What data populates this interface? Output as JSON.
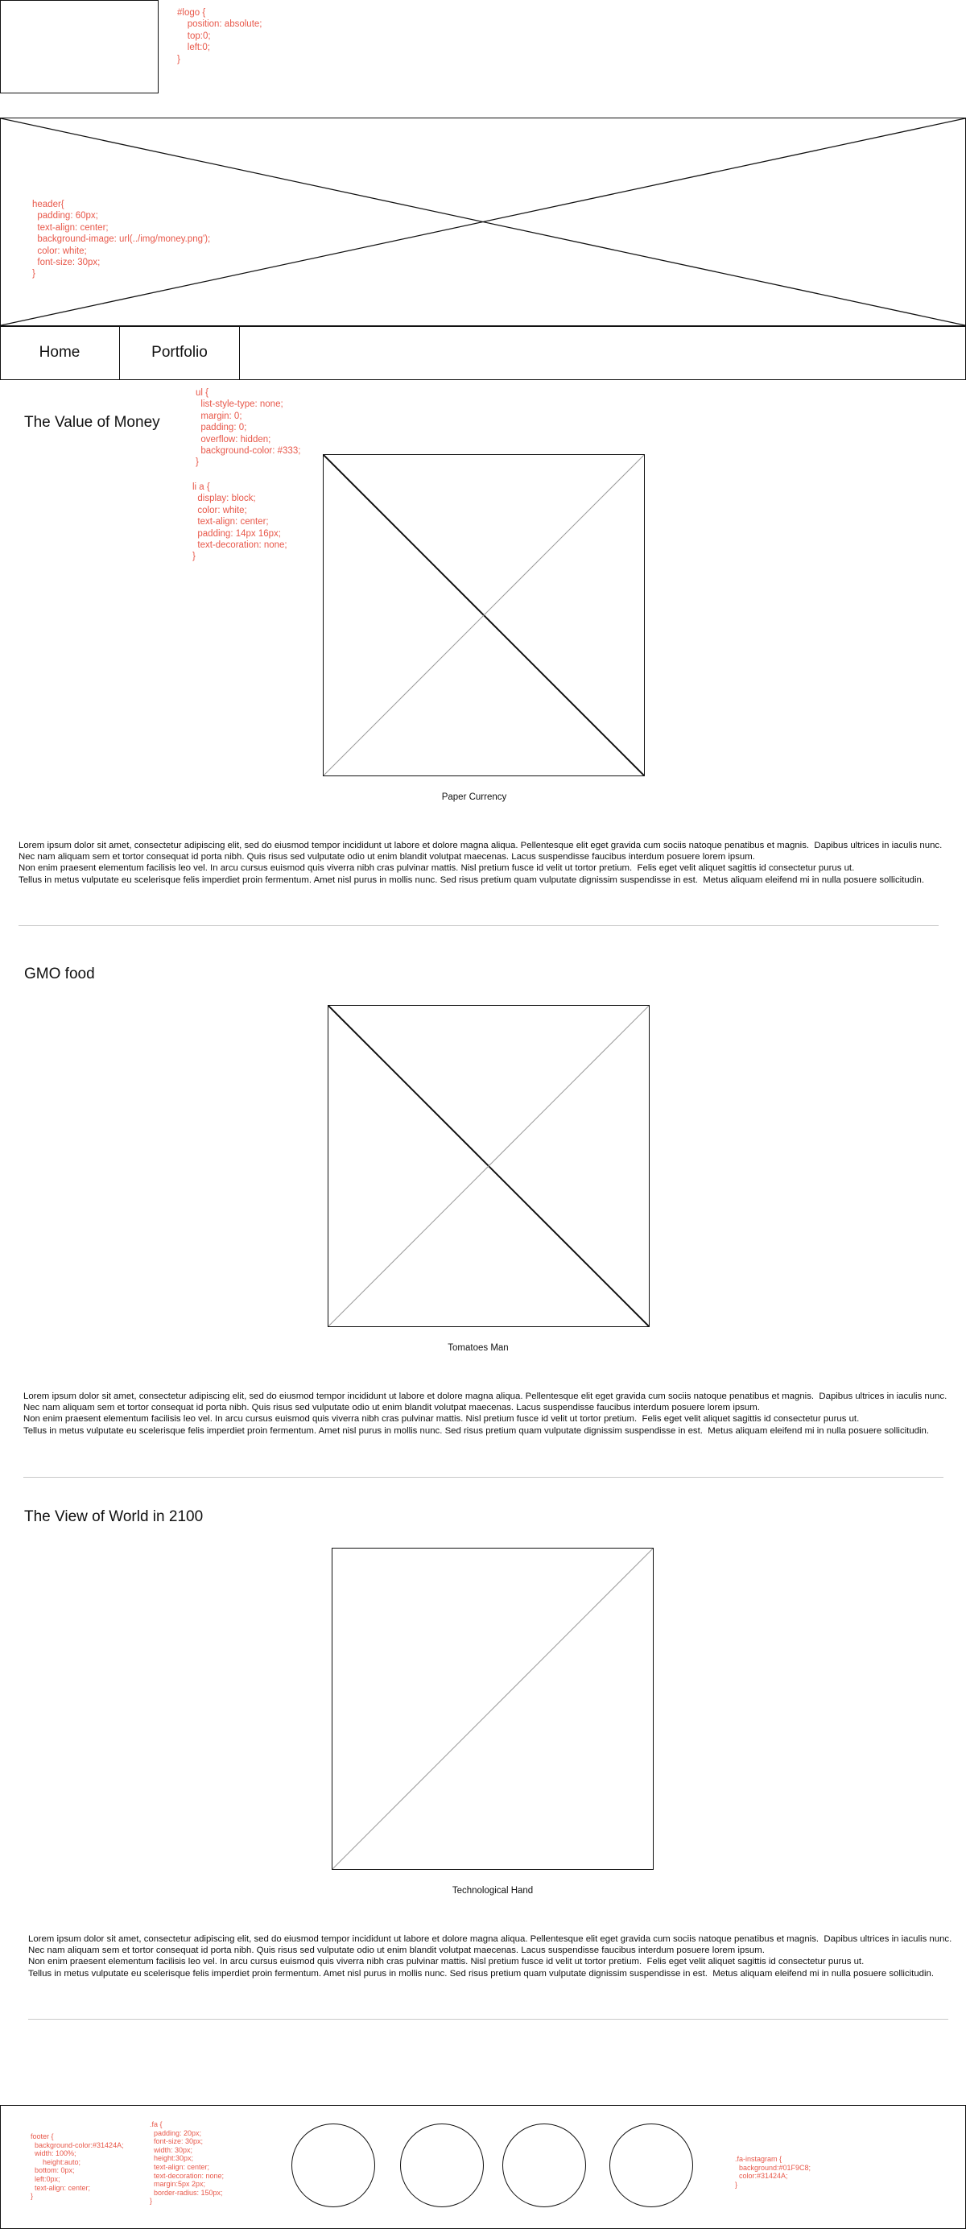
{
  "annotations": {
    "logo_css": "#logo {\n    position: absolute;\n    top:0;\n    left:0;\n}",
    "header_css": "header{\n  padding: 60px;\n  text-align: center;\n  background-image: url(../img/money.png');\n  color: white;\n  font-size: 30px;\n}",
    "ul_css": "ul {\n  list-style-type: none;\n  margin: 0;\n  padding: 0;\n  overflow: hidden;\n  background-color: #333;\n}",
    "li_a_css": "li a {\n  display: block;\n  color: white;\n  text-align: center;\n  padding: 14px 16px;\n  text-decoration: none;\n}",
    "footer_css": "footer {\n  background-color:#31424A;\n  width: 100%;\n      height:auto;\n  bottom: 0px;\n  left:0px;\n  text-align: center;\n}",
    "fa_css": ".fa {\n  padding: 20px;\n  font-size: 30px;\n  width: 30px;\n  height:30px;\n  text-align: center;\n  text-decoration: none;\n  margin:5px 2px;\n  border-radius: 150px;\n}",
    "fa_instagram_css": ".fa-instagram {\n  background:#01F9C8;\n  color:#31424A;\n}"
  },
  "nav": {
    "items": [
      {
        "label": "Home"
      },
      {
        "label": "Portfolio"
      }
    ]
  },
  "sections": [
    {
      "title": "The Value of Money",
      "caption": "Paper Currency",
      "text": "Lorem ipsum dolor sit amet, consectetur adipiscing elit, sed do eiusmod tempor incididunt ut labore et dolore magna aliqua. Pellentesque elit eget gravida cum sociis natoque penatibus et magnis.  Dapibus ultrices in iaculis nunc.\nNec nam aliquam sem et tortor consequat id porta nibh. Quis risus sed vulputate odio ut enim blandit volutpat maecenas. Lacus suspendisse faucibus interdum posuere lorem ipsum.\nNon enim praesent elementum facilisis leo vel. In arcu cursus euismod quis viverra nibh cras pulvinar mattis. Nisl pretium fusce id velit ut tortor pretium.  Felis eget velit aliquet sagittis id consectetur purus ut.\nTellus in metus vulputate eu scelerisque felis imperdiet proin fermentum. Amet nisl purus in mollis nunc. Sed risus pretium quam vulputate dignissim suspendisse in est.  Metus aliquam eleifend mi in nulla posuere sollicitudin."
    },
    {
      "title": "GMO food",
      "caption": "Tomatoes Man",
      "text": "Lorem ipsum dolor sit amet, consectetur adipiscing elit, sed do eiusmod tempor incididunt ut labore et dolore magna aliqua. Pellentesque elit eget gravida cum sociis natoque penatibus et magnis.  Dapibus ultrices in iaculis nunc.\nNec nam aliquam sem et tortor consequat id porta nibh. Quis risus sed vulputate odio ut enim blandit volutpat maecenas. Lacus suspendisse faucibus interdum posuere lorem ipsum.\nNon enim praesent elementum facilisis leo vel. In arcu cursus euismod quis viverra nibh cras pulvinar mattis. Nisl pretium fusce id velit ut tortor pretium.  Felis eget velit aliquet sagittis id consectetur purus ut.\nTellus in metus vulputate eu scelerisque felis imperdiet proin fermentum. Amet nisl purus in mollis nunc. Sed risus pretium quam vulputate dignissim suspendisse in est.  Metus aliquam eleifend mi in nulla posuere sollicitudin."
    },
    {
      "title": "The View of World in 2100",
      "caption": "Technological Hand",
      "text": "Lorem ipsum dolor sit amet, consectetur adipiscing elit, sed do eiusmod tempor incididunt ut labore et dolore magna aliqua. Pellentesque elit eget gravida cum sociis natoque penatibus et magnis.  Dapibus ultrices in iaculis nunc.\nNec nam aliquam sem et tortor consequat id porta nibh. Quis risus sed vulputate odio ut enim blandit volutpat maecenas. Lacus suspendisse faucibus interdum posuere lorem ipsum.\nNon enim praesent elementum facilisis leo vel. In arcu cursus euismod quis viverra nibh cras pulvinar mattis. Nisl pretium fusce id velit ut tortor pretium.  Felis eget velit aliquet sagittis id consectetur purus ut.\nTellus in metus vulputate eu scelerisque felis imperdiet proin fermentum. Amet nisl purus in mollis nunc. Sed risus pretium quam vulputate dignissim suspendisse in est.  Metus aliquam eleifend mi in nulla posuere sollicitudin."
    }
  ],
  "colors": {
    "annotation": "#e8584a",
    "wireframe_line": "#111111",
    "divider": "#c8c8c8"
  }
}
